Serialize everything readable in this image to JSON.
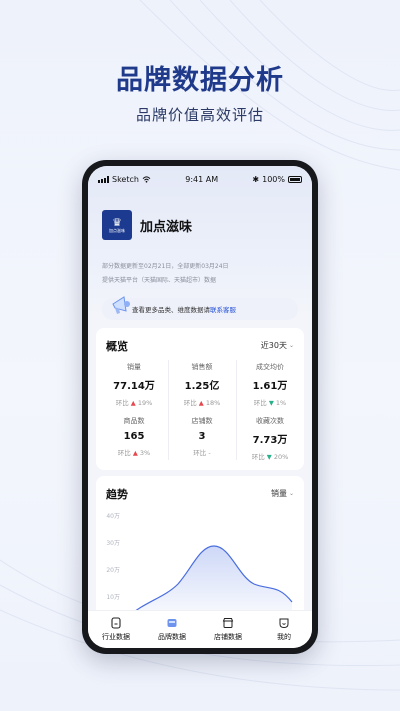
{
  "hero": {
    "title": "品牌数据分析",
    "subtitle": "品牌价值高效评估"
  },
  "status_bar": {
    "carrier": "Sketch",
    "time": "9:41 AM",
    "battery": "100%"
  },
  "brand": {
    "logo_text": "加点滋味",
    "name": "加点滋味"
  },
  "notes": {
    "update": "部分数据更新至02月21日，全部更新03月24日",
    "source": "提供天猫平台（天猫国际、天猫超市）数据"
  },
  "promo": {
    "text": "查看更多品类、维度数据请",
    "link": "联系客服"
  },
  "overview": {
    "title": "概览",
    "period": "近30天",
    "metrics": [
      {
        "label": "销量",
        "value": "77.14万",
        "change_label": "环比",
        "arrow": "▲",
        "change": "19%",
        "dir": "up"
      },
      {
        "label": "销售额",
        "value": "1.25亿",
        "change_label": "环比",
        "arrow": "▲",
        "change": "18%",
        "dir": "up"
      },
      {
        "label": "成交均价",
        "value": "1.61万",
        "change_label": "环比",
        "arrow": "▼",
        "change": "1%",
        "dir": "down"
      },
      {
        "label": "商品数",
        "value": "165",
        "change_label": "环比",
        "arrow": "▲",
        "change": "3%",
        "dir": "up"
      },
      {
        "label": "店铺数",
        "value": "3",
        "change_label": "环比",
        "arrow": "",
        "change": "-",
        "dir": "flat"
      },
      {
        "label": "收藏次数",
        "value": "7.73万",
        "change_label": "环比",
        "arrow": "▼",
        "change": "20%",
        "dir": "down"
      }
    ]
  },
  "trend": {
    "title": "趋势",
    "metric": "销量",
    "y_ticks": [
      "40万",
      "30万",
      "20万",
      "10万"
    ]
  },
  "tabbar": {
    "items": [
      {
        "label": "行业数据",
        "icon": "industry-icon"
      },
      {
        "label": "品牌数据",
        "icon": "brand-icon",
        "active": true
      },
      {
        "label": "店铺数据",
        "icon": "store-icon"
      },
      {
        "label": "我的",
        "icon": "profile-icon"
      }
    ]
  },
  "colors": {
    "accent": "#2854d9",
    "hero": "#1f3a8a",
    "up": "#e5484d",
    "down": "#28b08a"
  }
}
